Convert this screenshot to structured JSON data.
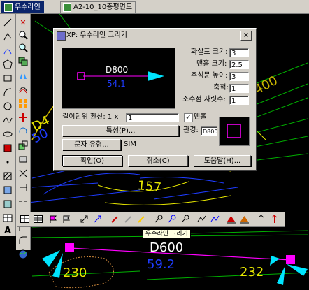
{
  "tabs": [
    {
      "label": "우수라인",
      "active": true
    },
    {
      "label": "A2-10_10층평면도",
      "active": false
    }
  ],
  "left_toolbar_1": [
    "line-icon",
    "polyline-icon",
    "arc-icon",
    "polygon-icon",
    "rectangle-icon",
    "arc2-icon",
    "circle-icon",
    "spline-icon",
    "ellipse-icon",
    "insert-block-icon",
    "point-icon",
    "hatch-icon",
    "gradient-icon",
    "region-icon",
    "table-icon",
    "text-icon"
  ],
  "left_toolbar_2": [
    "erase-icon",
    "zoom-icon",
    "zoom-window-icon",
    "copy-icon",
    "mirror-icon",
    "offset-icon",
    "array-icon",
    "move-icon",
    "rotate-icon",
    "scale-icon",
    "stretch-icon",
    "trim-icon",
    "extend-icon",
    "break-icon",
    "join-icon",
    "chamfer-icon",
    "fillet-icon",
    "explode-icon",
    "grid-icon",
    "properties-icon",
    "globe-icon"
  ],
  "dialog": {
    "title": "XP: 우수라인 그리기",
    "close": "×",
    "preview": {
      "pipe": "D800",
      "slope": "54.1"
    },
    "fields": [
      {
        "label": "화살표 크기:",
        "value": "3"
      },
      {
        "label": "맨홀 크기:",
        "value": "2.5"
      },
      {
        "label": "주석문 높이:",
        "value": "3"
      },
      {
        "label": "축척:",
        "value": "1"
      },
      {
        "label": "소수점 자릿수:",
        "value": "1"
      }
    ],
    "unit_label": "길이단위 환산: 1 x",
    "unit_value": "1",
    "manhole_check": "✓",
    "manhole_label": "맨홀",
    "props_button": "특성(P)...",
    "pipe_label": "관경:",
    "pipe_value": "D800",
    "text_style_button": "문자 유형...",
    "text_style_value": "SIM",
    "ok": "확인(O)",
    "cancel": "취소(C)",
    "help": "도움말(H)..."
  },
  "drawing": {
    "texts": {
      "d4": "D4",
      "n50": "50",
      "n400": "400",
      "n157": "157",
      "d600": "D600",
      "n592": "59.2",
      "n230": "230",
      "n232": "232"
    }
  },
  "bottom_toolbar": [
    "table-icon",
    "table2-icon",
    "flag-icon",
    "flag2-icon",
    "expand-icon",
    "expand2-icon",
    "pen-icon",
    "pen2-icon",
    "pen3-icon",
    "key-icon",
    "key2-icon",
    "key3-icon",
    "line-tool-icon",
    "line-tool2-icon",
    "triangle-icon",
    "triangle2-icon",
    "pin-icon",
    "pin2-icon"
  ],
  "tooltip": "우수라인 그리기",
  "colors": {
    "accent": "#0a246a",
    "preview_arrow": "#00e5ff",
    "preview_marker": "#ff00ff",
    "text_white": "#ffffff",
    "drawing_yellow": "#e8e800",
    "drawing_blue": "#1e2eff"
  }
}
